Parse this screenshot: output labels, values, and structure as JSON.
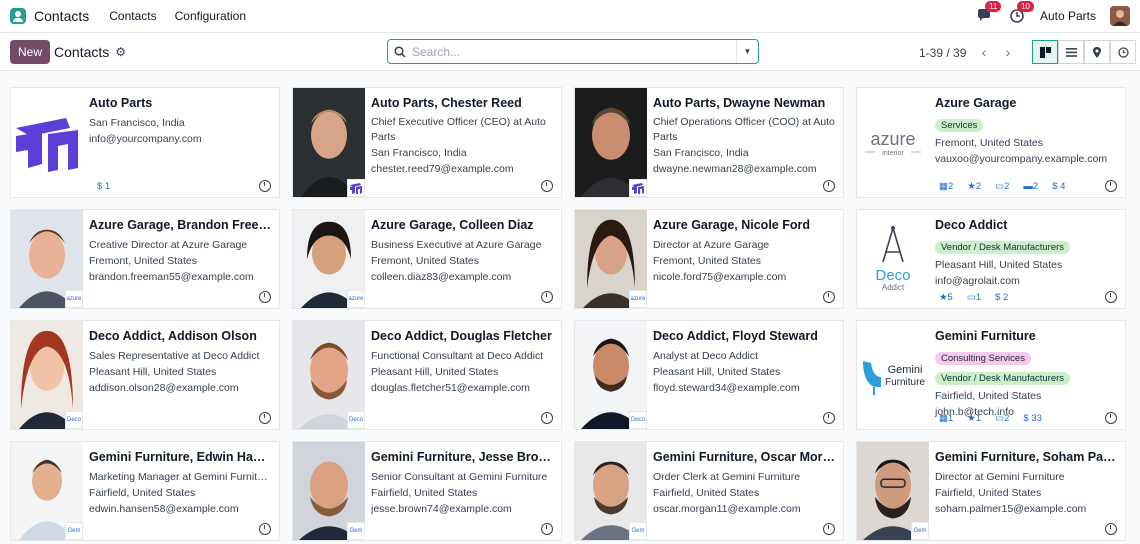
{
  "topbar": {
    "app_title": "Contacts",
    "menu": [
      "Contacts",
      "Configuration"
    ],
    "messages_count": "11",
    "activities_count": "10",
    "company": "Auto Parts"
  },
  "controlbar": {
    "new_label": "New",
    "title": "Contacts",
    "search_placeholder": "Search...",
    "pager": "1-39 / 39"
  },
  "cards": [
    {
      "title": "Auto Parts",
      "lines": [
        "San Francisco, India",
        "info@yourcompany.com"
      ],
      "stats": [
        "$ 1"
      ]
    },
    {
      "title": "Auto Parts, Chester Reed",
      "lines": [
        "Chief Executive Officer (CEO) at Auto Parts",
        "San Francisco, India",
        "chester.reed79@example.com"
      ]
    },
    {
      "title": "Auto Parts, Dwayne Newman",
      "lines": [
        "Chief Operations Officer (COO) at Auto Parts",
        "San Francisco, India",
        "dwayne.newman28@example.com"
      ]
    },
    {
      "title": "Azure Garage",
      "tags": [
        "Services"
      ],
      "lines": [
        "Fremont, United States",
        "vauxoo@yourcompany.example.com"
      ],
      "stats": [
        "2",
        "2",
        "2",
        "2",
        "$ 4"
      ]
    },
    {
      "title": "Azure Garage, Brandon Freeman",
      "lines": [
        "Creative Director at Azure Garage",
        "Fremont, United States",
        "brandon.freeman55@example.com"
      ]
    },
    {
      "title": "Azure Garage, Colleen Diaz",
      "lines": [
        "Business Executive at Azure Garage",
        "Fremont, United States",
        "colleen.diaz83@example.com"
      ]
    },
    {
      "title": "Azure Garage, Nicole Ford",
      "lines": [
        "Director at Azure Garage",
        "Fremont, United States",
        "nicole.ford75@example.com"
      ]
    },
    {
      "title": "Deco Addict",
      "tags": [
        "Vendor / Desk Manufacturers"
      ],
      "lines": [
        "Pleasant Hill, United States",
        "info@agrolait.com"
      ],
      "stats": [
        "5",
        "1",
        "$ 2"
      ]
    },
    {
      "title": "Deco Addict, Addison Olson",
      "lines": [
        "Sales Representative at Deco Addict",
        "Pleasant Hill, United States",
        "addison.olson28@example.com"
      ]
    },
    {
      "title": "Deco Addict, Douglas Fletcher",
      "lines": [
        "Functional Consultant at Deco Addict",
        "Pleasant Hill, United States",
        "douglas.fletcher51@example.com"
      ]
    },
    {
      "title": "Deco Addict, Floyd Steward",
      "lines": [
        "Analyst at Deco Addict",
        "Pleasant Hill, United States",
        "floyd.steward34@example.com"
      ]
    },
    {
      "title": "Gemini Furniture",
      "tags": [
        "Consulting Services",
        "Vendor / Desk Manufacturers"
      ],
      "lines": [
        "Fairfield, United States",
        "john.b@tech.info"
      ],
      "stats": [
        "1",
        "1",
        "2",
        "$ 33"
      ]
    },
    {
      "title": "Gemini Furniture, Edwin Hansen",
      "lines": [
        "Marketing Manager at Gemini Furniture",
        "Fairfield, United States",
        "edwin.hansen58@example.com"
      ]
    },
    {
      "title": "Gemini Furniture, Jesse Brown",
      "lines": [
        "Senior Consultant at Gemini Furniture",
        "Fairfield, United States",
        "jesse.brown74@example.com"
      ]
    },
    {
      "title": "Gemini Furniture, Oscar Morgan",
      "lines": [
        "Order Clerk at Gemini Furniture",
        "Fairfield, United States",
        "oscar.morgan11@example.com"
      ]
    },
    {
      "title": "Gemini Furniture, Soham Palmer",
      "lines": [
        "Director at Gemini Furniture",
        "Fairfield, United States",
        "soham.palmer15@example.com"
      ]
    }
  ],
  "logos": {
    "azure_word": "azure",
    "azure_sub": "interior",
    "deco_word": "Deco",
    "deco_sub": "Addict",
    "gemini_word": "Gemini",
    "gemini_sub": "Furniture"
  },
  "colors": {
    "accent": "#1f9f8c",
    "brand": "#714b67",
    "badge": "#e11d48",
    "link": "#1f6fd1"
  }
}
